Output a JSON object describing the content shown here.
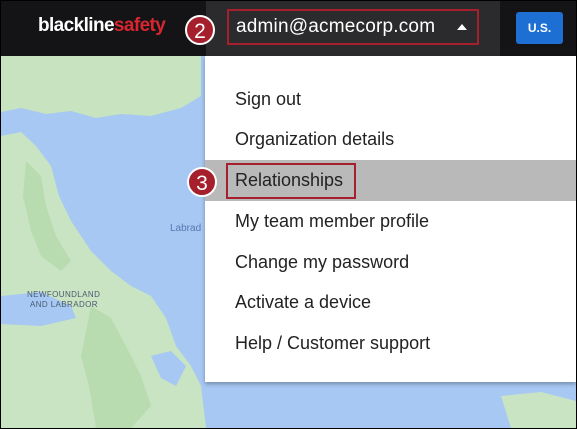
{
  "brand": {
    "part1": "blackline",
    "part2": "safety"
  },
  "header": {
    "account_email": "admin@acmecorp.com",
    "region_label": "U.S."
  },
  "callouts": {
    "account": "2",
    "relationships": "3"
  },
  "map": {
    "labels": [
      "NEWFOUNDLAND",
      "AND LABRADOR"
    ],
    "water_label": "Labrad"
  },
  "menu": {
    "items": [
      {
        "label": "Sign out"
      },
      {
        "label": "Organization details"
      },
      {
        "label": "Relationships"
      },
      {
        "label": "My team member profile"
      },
      {
        "label": "Change my password"
      },
      {
        "label": "Activate a device"
      },
      {
        "label": "Help / Customer support"
      }
    ],
    "active_index": 2
  }
}
